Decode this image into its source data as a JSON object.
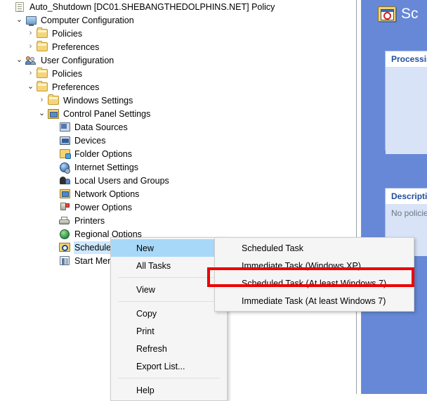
{
  "tree": {
    "items": [
      {
        "label": "Auto_Shutdown [DC01.SHEBANGTHEDOLPHINS.NET] Policy",
        "indent": 0,
        "twisty": "none",
        "icon": "policy-document-icon",
        "selected": false
      },
      {
        "label": "Computer Configuration",
        "indent": 1,
        "twisty": "open",
        "icon": "computer-icon",
        "selected": false
      },
      {
        "label": "Policies",
        "indent": 2,
        "twisty": "closed",
        "icon": "folder-icon",
        "selected": false
      },
      {
        "label": "Preferences",
        "indent": 2,
        "twisty": "closed",
        "icon": "folder-icon",
        "selected": false
      },
      {
        "label": "User Configuration",
        "indent": 1,
        "twisty": "open",
        "icon": "users-icon",
        "selected": false
      },
      {
        "label": "Policies",
        "indent": 2,
        "twisty": "closed",
        "icon": "folder-icon",
        "selected": false
      },
      {
        "label": "Preferences",
        "indent": 2,
        "twisty": "open",
        "icon": "folder-icon",
        "selected": false
      },
      {
        "label": "Windows Settings",
        "indent": 3,
        "twisty": "closed",
        "icon": "folder-icon",
        "selected": false
      },
      {
        "label": "Control Panel Settings",
        "indent": 3,
        "twisty": "open",
        "icon": "control-panel-icon",
        "selected": false
      },
      {
        "label": "Data Sources",
        "indent": 4,
        "twisty": "none",
        "icon": "data-sources-icon",
        "selected": false
      },
      {
        "label": "Devices",
        "indent": 4,
        "twisty": "none",
        "icon": "devices-icon",
        "selected": false
      },
      {
        "label": "Folder Options",
        "indent": 4,
        "twisty": "none",
        "icon": "folder-options-icon",
        "selected": false
      },
      {
        "label": "Internet Settings",
        "indent": 4,
        "twisty": "none",
        "icon": "internet-settings-icon",
        "selected": false
      },
      {
        "label": "Local Users and Groups",
        "indent": 4,
        "twisty": "none",
        "icon": "local-users-and-groups-icon",
        "selected": false
      },
      {
        "label": "Network Options",
        "indent": 4,
        "twisty": "none",
        "icon": "network-options-icon",
        "selected": false
      },
      {
        "label": "Power Options",
        "indent": 4,
        "twisty": "none",
        "icon": "power-options-icon",
        "selected": false
      },
      {
        "label": "Printers",
        "indent": 4,
        "twisty": "none",
        "icon": "printers-icon",
        "selected": false
      },
      {
        "label": "Regional Options",
        "indent": 4,
        "twisty": "none",
        "icon": "regional-options-icon",
        "selected": false
      },
      {
        "label": "Scheduled Tasks",
        "indent": 4,
        "twisty": "none",
        "icon": "scheduled-tasks-icon",
        "selected": true
      },
      {
        "label": "Start Menu",
        "indent": 4,
        "twisty": "none",
        "icon": "start-menu-icon",
        "selected": false
      }
    ],
    "twisty_glyphs": {
      "open": "⌄",
      "closed": "›"
    }
  },
  "details": {
    "title": "Sc",
    "icon": "scheduled-tasks-large-icon",
    "panels": [
      {
        "title": "Processing",
        "body": ""
      },
      {
        "title": "Description",
        "body": "No policies"
      }
    ]
  },
  "context_menu": {
    "items": [
      {
        "label": "New",
        "submenu": true,
        "highlighted": true,
        "separator_after": false
      },
      {
        "label": "All Tasks",
        "submenu": true,
        "highlighted": false,
        "separator_after": true
      },
      {
        "label": "View",
        "submenu": true,
        "highlighted": false,
        "separator_after": true
      },
      {
        "label": "Copy",
        "submenu": false,
        "highlighted": false,
        "separator_after": false
      },
      {
        "label": "Print",
        "submenu": false,
        "highlighted": false,
        "separator_after": false
      },
      {
        "label": "Refresh",
        "submenu": false,
        "highlighted": false,
        "separator_after": false
      },
      {
        "label": "Export List...",
        "submenu": false,
        "highlighted": false,
        "separator_after": true
      },
      {
        "label": "Help",
        "submenu": false,
        "highlighted": false,
        "separator_after": false
      }
    ],
    "submenu_arrow": "›"
  },
  "submenu": {
    "items": [
      {
        "label": "Scheduled Task",
        "annotated": false
      },
      {
        "label": "Immediate Task (Windows XP)",
        "annotated": false
      },
      {
        "label": "Scheduled Task (At least Windows 7)",
        "annotated": true
      },
      {
        "label": "Immediate Task (At least Windows 7)",
        "annotated": false
      }
    ]
  },
  "colors": {
    "selection_blue": "#cde8ff",
    "menu_highlight": "#a8d8f8",
    "details_background": "#6688d6",
    "panel_body": "#d9e3f7",
    "panel_title_text": "#1f4fa0",
    "annotation_red": "#ef0000"
  }
}
